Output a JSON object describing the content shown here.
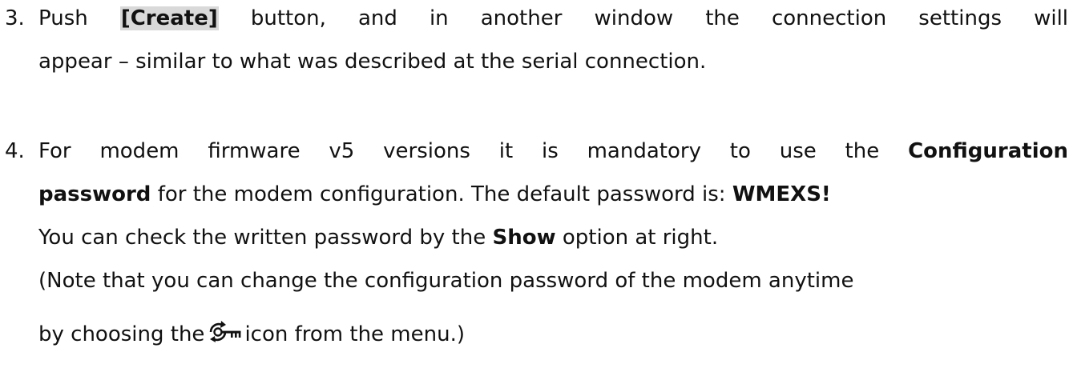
{
  "item3": {
    "number": "3.",
    "push": "Push",
    "create_label": "[Create]",
    "line1_rest": "button, and in another window the connection settings will",
    "line2": "appear – similar to what was described at the serial connection."
  },
  "item4": {
    "number": "4.",
    "line1_pre": "For modem firmware v5 versions it is mandatory to use the",
    "line1_bold": "Configuration",
    "line2_bold": "password",
    "line2_mid": "for the modem configuration. The default password is:",
    "line2_password": "WMEXS!",
    "line3_pre": "You can check the written password by the",
    "line3_bold": "Show",
    "line3_post": "option at right.",
    "line4": "(Note that you can change the configuration password of the modem anytime",
    "line5_pre": "by choosing the",
    "icon_name": "password-change-icon",
    "line5_post": "icon from the menu.)"
  }
}
